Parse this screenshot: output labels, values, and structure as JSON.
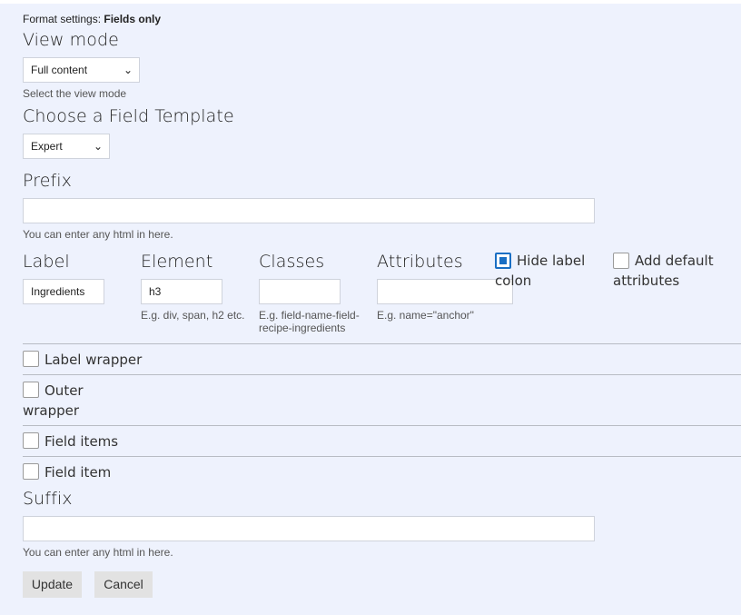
{
  "format_settings": {
    "prefix_label": "Format settings:",
    "value": "Fields only"
  },
  "view_mode": {
    "heading": "View mode",
    "selected": "Full content",
    "description": "Select the view mode"
  },
  "field_template": {
    "heading": "Choose a Field Template",
    "selected": "Expert"
  },
  "prefix": {
    "heading": "Prefix",
    "value": "",
    "description": "You can enter any html in here."
  },
  "label_row": {
    "label": {
      "heading": "Label",
      "value": "Ingredients"
    },
    "element": {
      "heading": "Element",
      "value": "h3",
      "description": "E.g. div, span, h2 etc."
    },
    "classes": {
      "heading": "Classes",
      "value": "",
      "description_line1": "E.g. field-name-field-",
      "description_line2": "recipe-ingredients"
    },
    "attributes": {
      "heading": "Attributes",
      "value": "",
      "description": "E.g. name=\"anchor\""
    },
    "hide_label_colon": {
      "line1": "Hide label",
      "line2": "colon",
      "checked": true
    },
    "add_default_attributes": {
      "line1": "Add default",
      "line2": "attributes",
      "checked": false
    }
  },
  "sections": {
    "label_wrapper": "Label wrapper",
    "outer_wrapper_line1": "Outer",
    "outer_wrapper_line2": "wrapper",
    "field_items": "Field items",
    "field_item": "Field item"
  },
  "suffix": {
    "heading": "Suffix",
    "value": "",
    "description": "You can enter any html in here."
  },
  "buttons": {
    "update": "Update",
    "cancel": "Cancel"
  },
  "colors": {
    "panel_bg": "#eef2fd",
    "checkbox_checked": "#1a6fc4",
    "button_bg": "#e2e2e2"
  },
  "icons": {
    "select_chevron": "chevron-down-icon"
  }
}
